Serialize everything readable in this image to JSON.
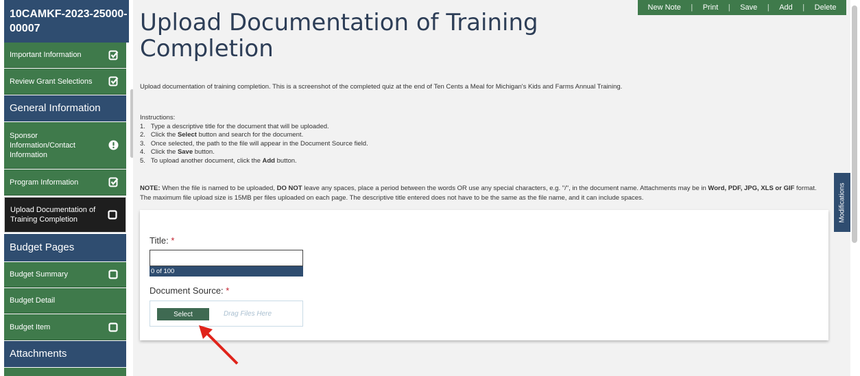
{
  "sidebar": {
    "title": "10CAMKF-2023-25000-00007",
    "items": [
      {
        "label": "Important Information",
        "icon": "checked-box-icon"
      },
      {
        "label": "Review Grant Selections",
        "icon": "checked-box-icon"
      },
      {
        "label": "General Information",
        "icon": ""
      },
      {
        "label": "Sponsor Information/Contact Information",
        "icon": "alert-circle-icon"
      },
      {
        "label": "Program Information",
        "icon": "checked-box-icon"
      },
      {
        "label": "Upload Documentation of Training Completion",
        "icon": "empty-box-icon"
      },
      {
        "label": "Budget Pages",
        "icon": ""
      },
      {
        "label": "Budget Summary",
        "icon": "empty-box-icon"
      },
      {
        "label": "Budget Detail",
        "icon": ""
      },
      {
        "label": "Budget Item",
        "icon": "empty-box-icon"
      },
      {
        "label": "Attachments",
        "icon": ""
      }
    ]
  },
  "toolbar": {
    "new_note": "New Note",
    "print": "Print",
    "save": "Save",
    "add": "Add",
    "delete": "Delete"
  },
  "page": {
    "title": "Upload Documentation of Training Completion",
    "description": "Upload documentation of training completion. This is a screenshot of the completed quiz at the end of Ten Cents a Meal for Michigan's Kids and Farms Annual Training.",
    "instructions_heading": "Instructions:",
    "instructions": [
      {
        "num": "1.",
        "pre": "Type a descriptive title for the document that will be uploaded.",
        "bold": "",
        "post": ""
      },
      {
        "num": "2.",
        "pre": "Click the ",
        "bold": "Select",
        "post": " button and search for the document."
      },
      {
        "num": "3.",
        "pre": "Once selected, the path to the file will appear in the Document Source field.",
        "bold": "",
        "post": ""
      },
      {
        "num": "4.",
        "pre": "Click the ",
        "bold": "Save",
        "post": " button."
      },
      {
        "num": "5.",
        "pre": "To upload another document, click the ",
        "bold": "Add",
        "post": " button."
      }
    ],
    "note": {
      "label": "NOTE:",
      "text1": " When the file is named to be uploaded, ",
      "bold1": "DO NOT",
      "text2": " leave any spaces, place a period between the words OR use any special characters, e.g. \"/\", in the document name. Attachments may be in ",
      "bold2": "Word, PDF, JPG, XLS or GIF",
      "text3": " format. The maximum file upload size is 15MB per files uploaded on each page. The descriptive title entered does not have to be the same as the file name, and it can include spaces."
    }
  },
  "form": {
    "title_label": "Title:",
    "required_mark": "*",
    "title_value": "",
    "title_counter": "0 of 100",
    "doc_source_label": "Document Source:",
    "select_button": "Select",
    "drag_text": "Drag Files Here"
  },
  "modifications_tab": "Modifications",
  "colors": {
    "navy": "#2f4d70",
    "green": "#3f7a4b",
    "active": "#1e1e1e",
    "required": "#c21e2b",
    "arrow": "#e0241b"
  }
}
